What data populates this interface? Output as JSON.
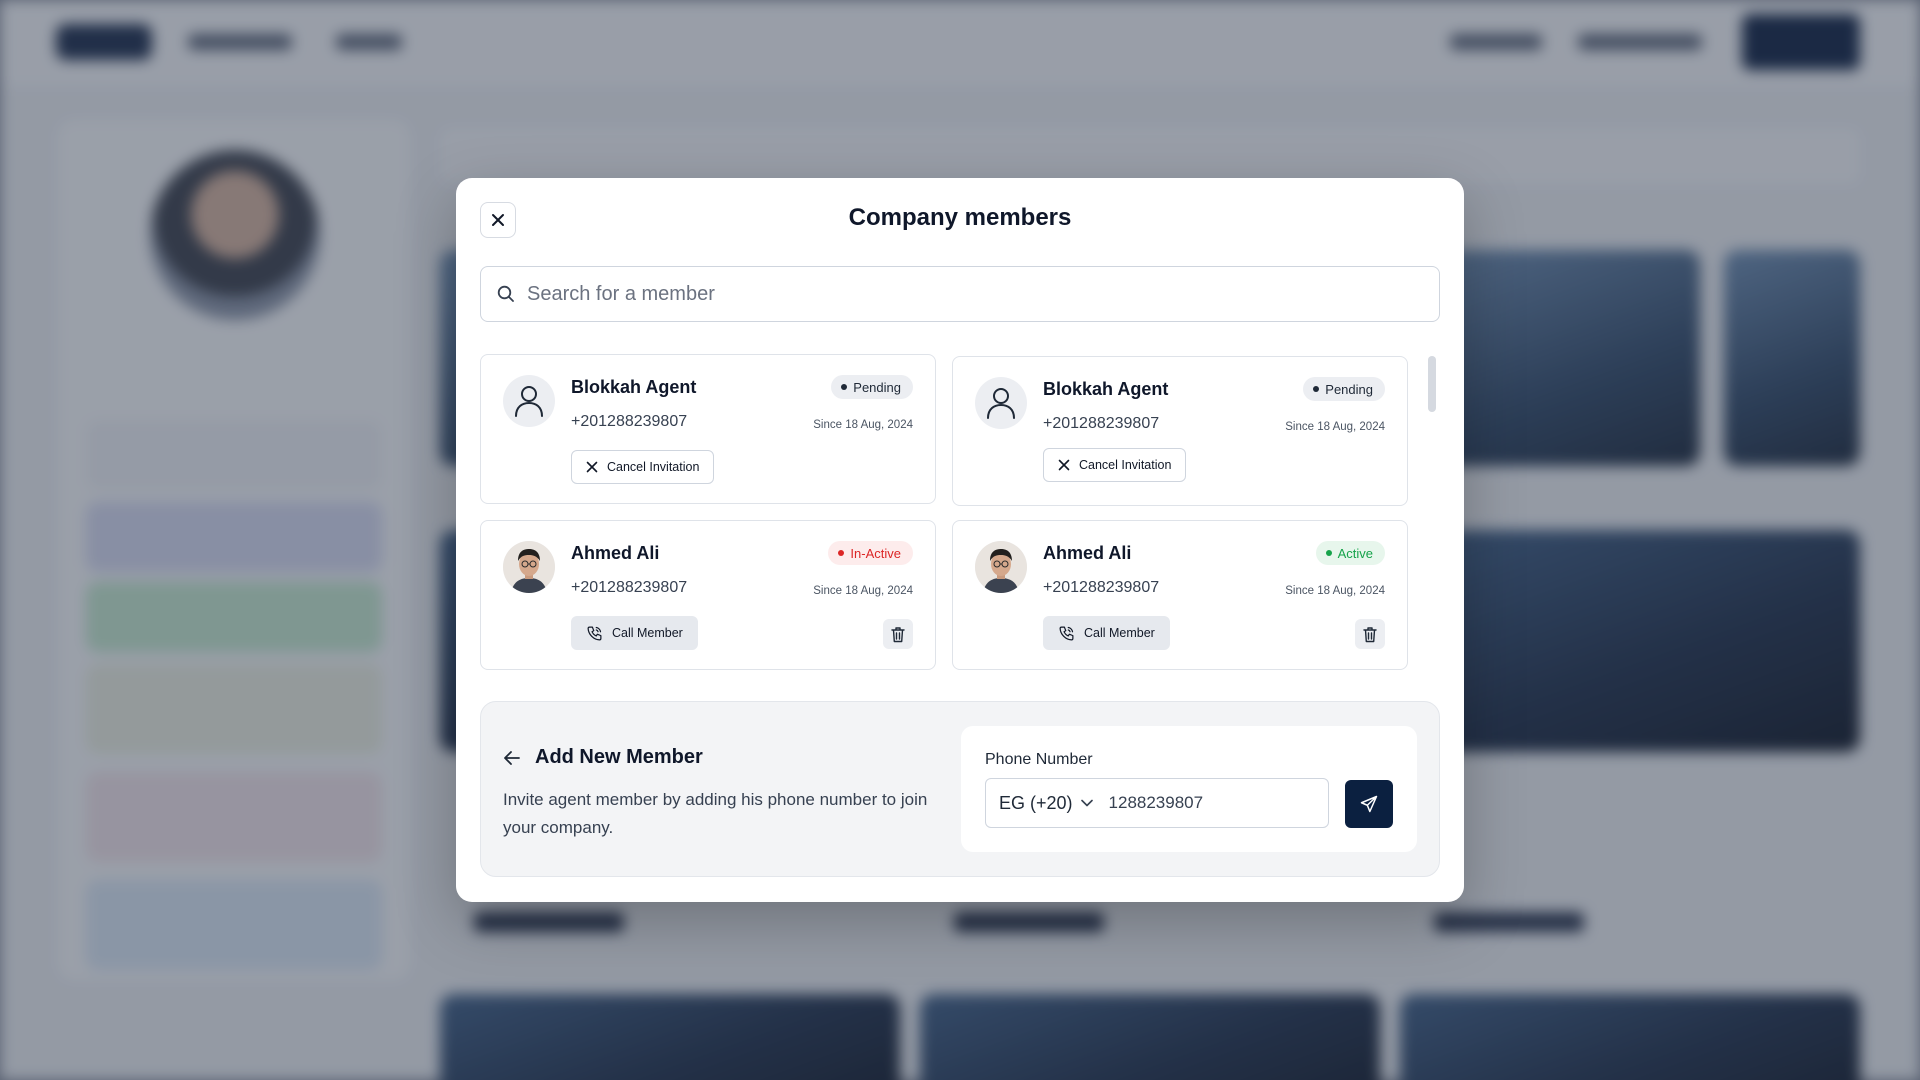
{
  "modal": {
    "title": "Company members",
    "search_placeholder": "Search for a member"
  },
  "members": [
    {
      "name": "Blokkah Agent",
      "phone": "+201288239807",
      "status": "Pending",
      "since": "Since 18 Aug, 2024",
      "action_label": "Cancel Invitation",
      "avatar": "user-placeholder-icon"
    },
    {
      "name": "Blokkah Agent",
      "phone": "+201288239807",
      "status": "Pending",
      "since": "Since 18 Aug, 2024",
      "action_label": "Cancel Invitation",
      "avatar": "user-placeholder-icon"
    },
    {
      "name": "Ahmed Ali",
      "phone": "+201288239807",
      "status": "In-Active",
      "since": "Since 18 Aug, 2024",
      "action_label": "Call Member",
      "avatar": "photo"
    },
    {
      "name": "Ahmed Ali",
      "phone": "+201288239807",
      "status": "Active",
      "since": "Since 18 Aug, 2024",
      "action_label": "Call Member",
      "avatar": "photo"
    }
  ],
  "add_member": {
    "title": "Add New Member",
    "description": "Invite agent member by adding his phone number to join your company.",
    "phone_label": "Phone Number",
    "country_code": "EG (+20)",
    "phone_value": "1288239807"
  },
  "colors": {
    "primary": "#0b2040",
    "status_pending": "#1f2937",
    "status_inactive": "#dc2626",
    "status_active": "#16a34a"
  }
}
